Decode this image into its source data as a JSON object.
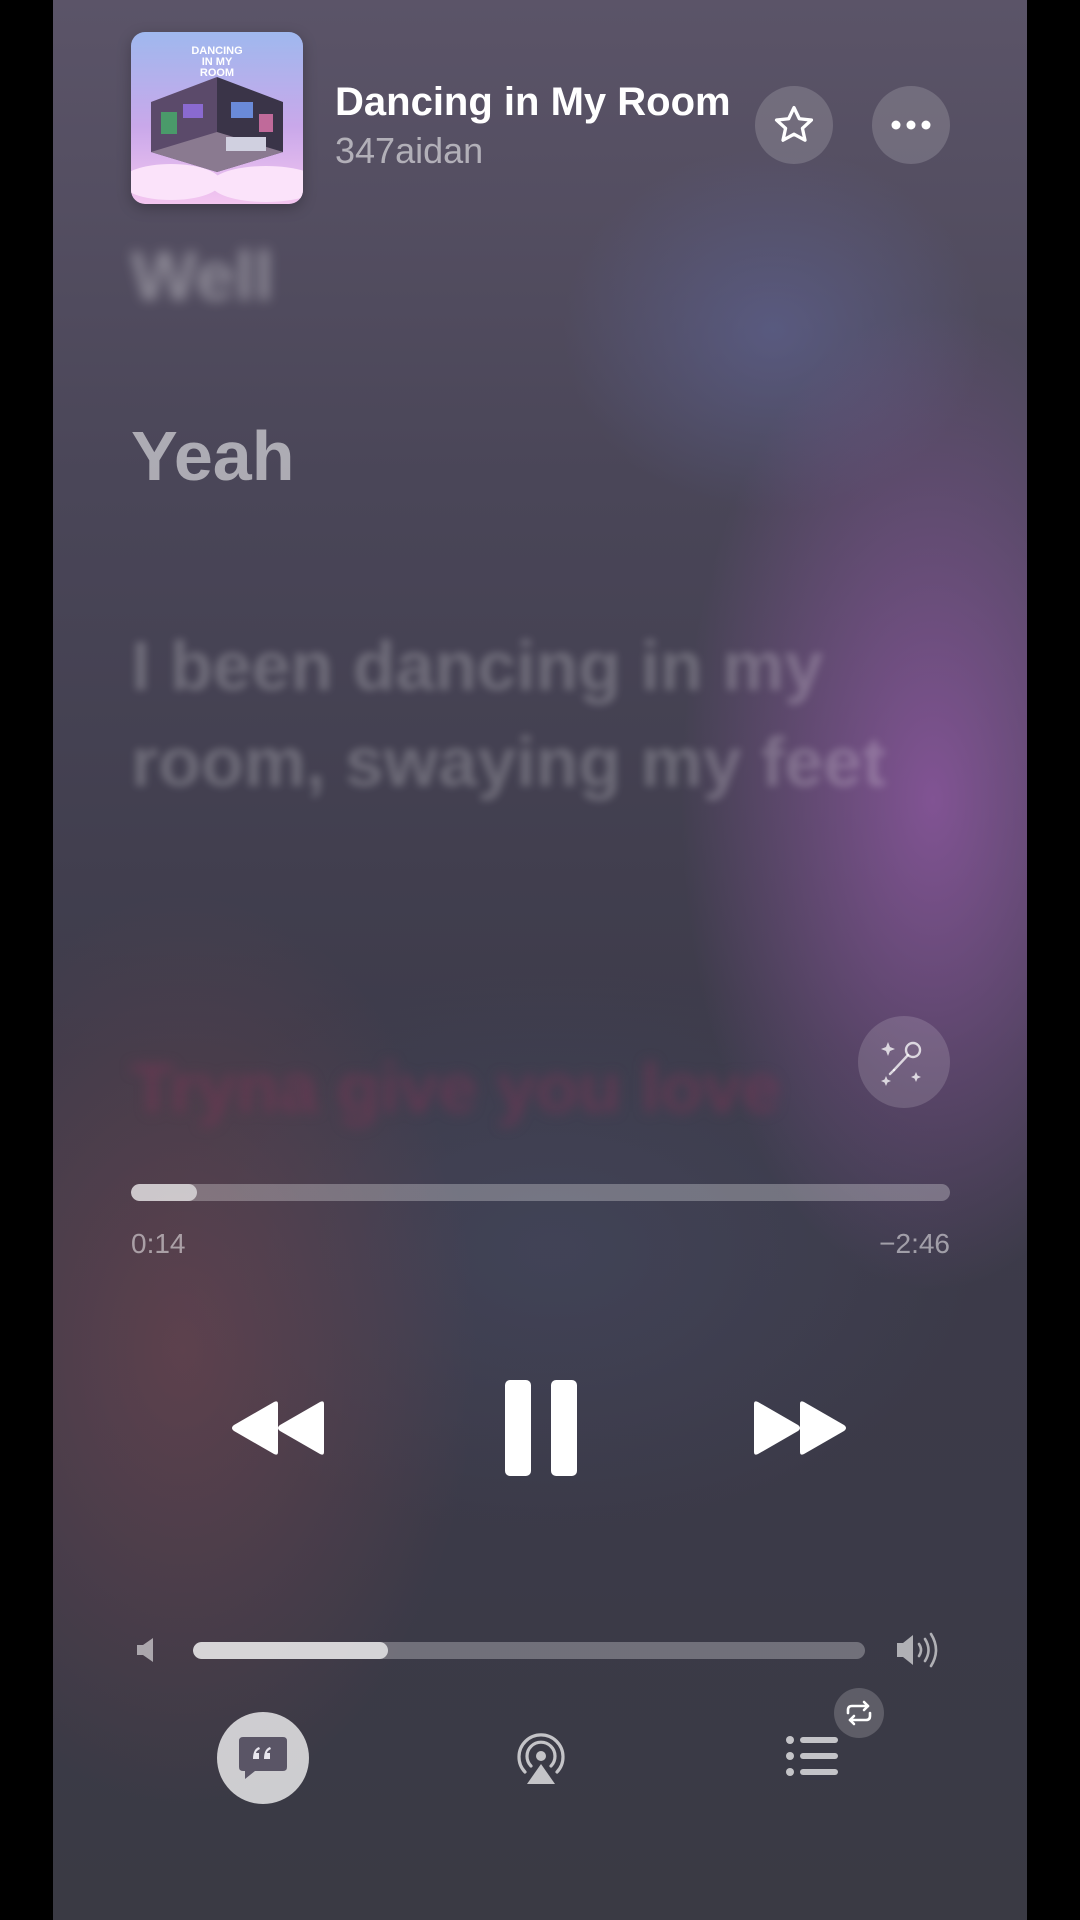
{
  "now_playing": {
    "title": "Dancing in My Room",
    "artist": "347aidan",
    "artwork_icon": "album-artwork"
  },
  "header_actions": {
    "favorite_icon": "star-icon",
    "more_icon": "ellipsis-icon"
  },
  "lyrics": {
    "lines": [
      "Well",
      "Yeah",
      "I been dancing in my room, swaying my feet",
      "Tryna give you love"
    ],
    "sing_icon": "sparkle-microphone-icon"
  },
  "playback": {
    "elapsed": "0:14",
    "remaining": "−2:46",
    "progress_fraction": 0.08
  },
  "transport": {
    "rewind_icon": "backward-icon",
    "pause_icon": "pause-icon",
    "forward_icon": "forward-icon"
  },
  "volume": {
    "level_fraction": 0.29,
    "low_icon": "speaker-low-icon",
    "high_icon": "speaker-high-icon"
  },
  "bottom_bar": {
    "lyrics_icon": "lyrics-quote-icon",
    "airplay_icon": "airplay-icon",
    "queue_icon": "queue-list-icon",
    "repeat_icon": "repeat-icon"
  },
  "colors": {
    "accent": "#ffffff",
    "background_top": "#5b5468",
    "background_bottom": "#3a3a44",
    "highlight_purple": "#9a5ab0"
  }
}
